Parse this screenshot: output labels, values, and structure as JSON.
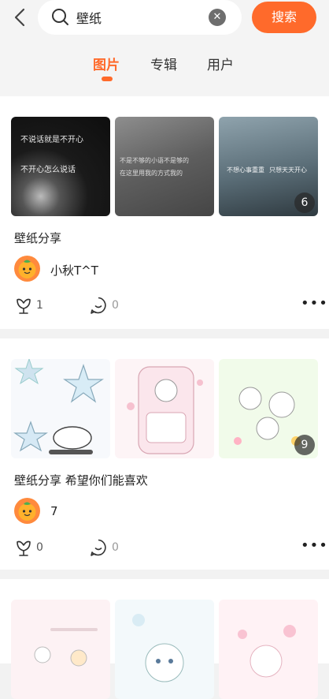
{
  "search": {
    "query": "壁纸",
    "button_label": "搜索"
  },
  "tabs": [
    {
      "label": "图片",
      "active": true
    },
    {
      "label": "专辑",
      "active": false
    },
    {
      "label": "用户",
      "active": false
    }
  ],
  "posts": [
    {
      "title": "壁纸分享",
      "author": "小秋T^T",
      "likes": "1",
      "comments": "0",
      "image_count": "6",
      "thumb_texts": [
        "不说话就是不开心",
        "不开心怎么说话",
        "不是不够的小语不是够的",
        "在这里用我的方式我的",
        "不想心事重重",
        "只想天天开心"
      ]
    },
    {
      "title": "壁纸分享 希望你们能喜欢",
      "author": "7",
      "likes": "0",
      "comments": "0",
      "image_count": "9"
    },
    {}
  ],
  "colors": {
    "accent": "#ff6a2b"
  }
}
